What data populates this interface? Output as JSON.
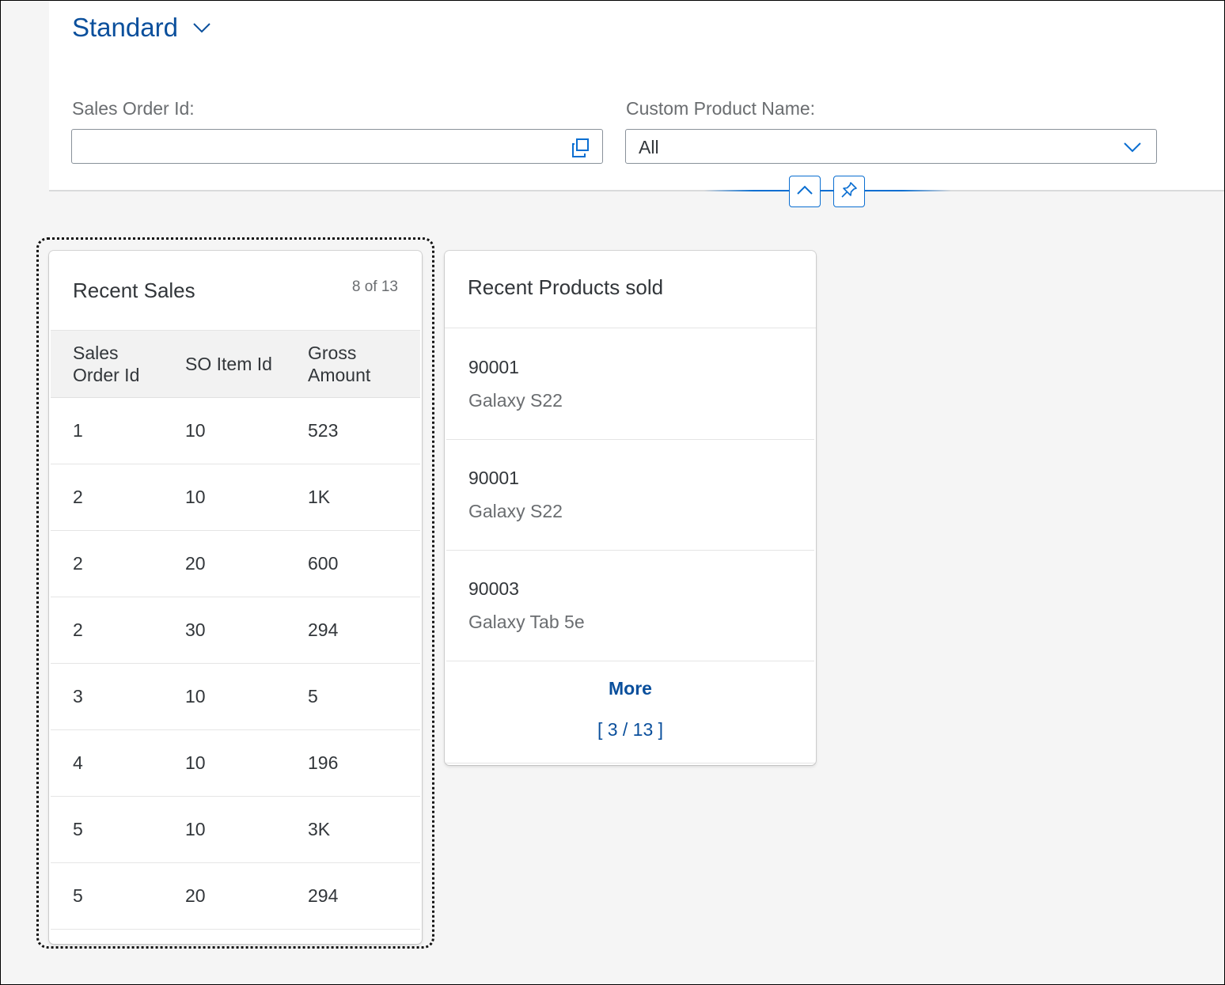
{
  "variant": {
    "title": "Standard"
  },
  "filters": {
    "sales_order_label": "Sales Order Id:",
    "sales_order_value": "",
    "product_label": "Custom Product Name:",
    "product_value": "All"
  },
  "recent_sales": {
    "title": "Recent Sales",
    "count": "8 of 13",
    "columns": [
      "Sales Order Id",
      "SO Item Id",
      "Gross Amount"
    ],
    "rows": [
      [
        "1",
        "10",
        "523"
      ],
      [
        "2",
        "10",
        "1K"
      ],
      [
        "2",
        "20",
        "600"
      ],
      [
        "2",
        "30",
        "294"
      ],
      [
        "3",
        "10",
        "5"
      ],
      [
        "4",
        "10",
        "196"
      ],
      [
        "5",
        "10",
        "3K"
      ],
      [
        "5",
        "20",
        "294"
      ]
    ]
  },
  "recent_products": {
    "title": "Recent Products sold",
    "items": [
      {
        "id": "90001",
        "name": "Galaxy S22"
      },
      {
        "id": "90001",
        "name": "Galaxy S22"
      },
      {
        "id": "90003",
        "name": "Galaxy Tab 5e"
      }
    ],
    "more_label": "More",
    "more_count": "[ 3 / 13 ]"
  },
  "icons": {
    "variant": "chevron-down-icon",
    "value_help": "value-help-icon",
    "dropdown": "chevron-down-icon",
    "collapse": "chevron-up-icon",
    "pin": "pin-icon"
  },
  "colors": {
    "accent": "#0a6ed1",
    "title": "#0a4f9c"
  }
}
